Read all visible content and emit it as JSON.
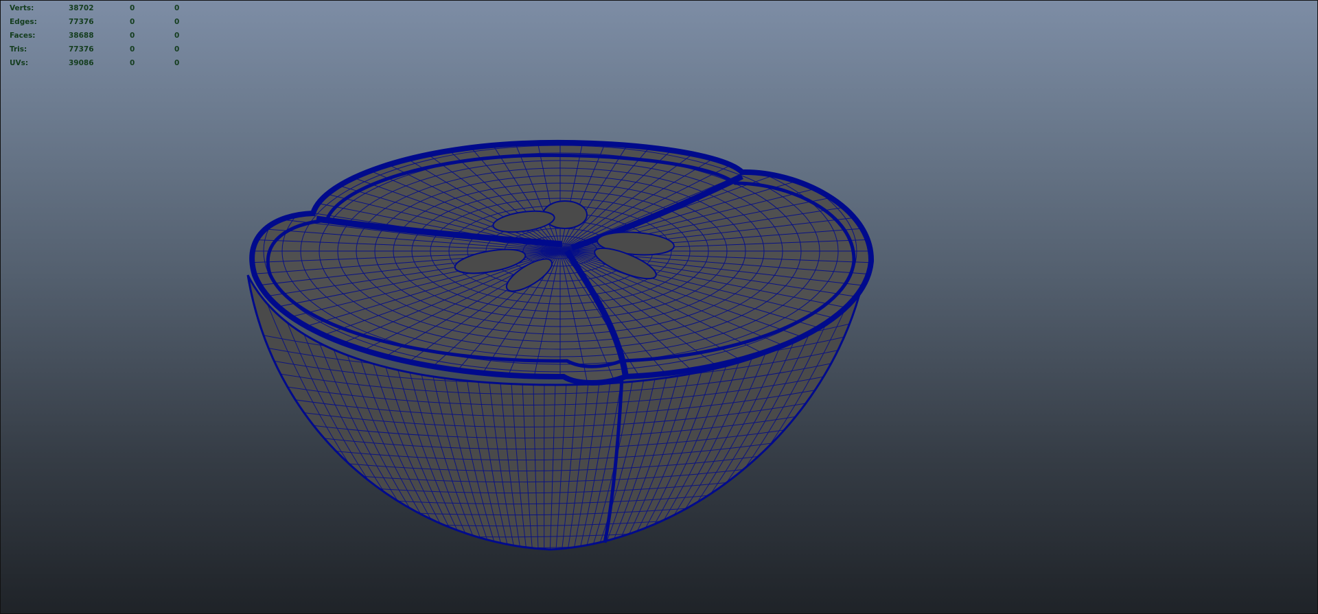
{
  "colors": {
    "wire": "#000a8c",
    "mesh_fill": "#4e4e4e",
    "hud_text": "#143d1e"
  },
  "hud": {
    "rows": [
      {
        "label": "Verts:",
        "v1": "38702",
        "v2": "0",
        "v3": "0"
      },
      {
        "label": "Edges:",
        "v1": "77376",
        "v2": "0",
        "v3": "0"
      },
      {
        "label": "Faces:",
        "v1": "38688",
        "v2": "0",
        "v3": "0"
      },
      {
        "label": "Tris:",
        "v1": "77376",
        "v2": "0",
        "v3": "0"
      },
      {
        "label": "UVs:",
        "v1": "39086",
        "v2": "0",
        "v3": "0"
      }
    ]
  },
  "viewport": {
    "object_icon": "half-citrus-wireframe-mesh"
  }
}
